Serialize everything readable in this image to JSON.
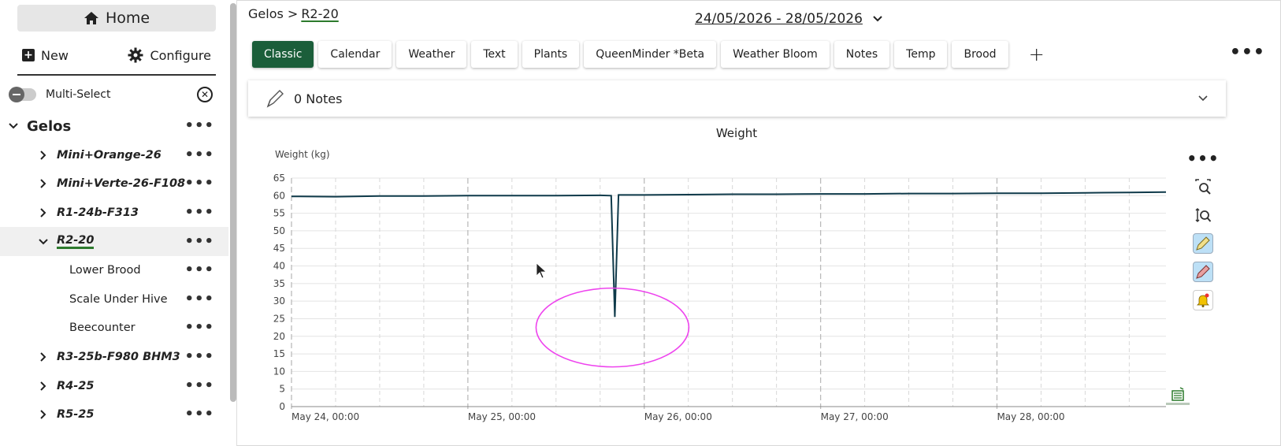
{
  "sidebar": {
    "home_label": "Home",
    "new_label": "New",
    "configure_label": "Configure",
    "multiselect_label": "Multi-Select",
    "tree": [
      {
        "type": "root",
        "label": "Gelos",
        "expanded": true
      },
      {
        "type": "hive",
        "label": "Mini+Orange-26",
        "expanded": false
      },
      {
        "type": "hive",
        "label": "Mini+Verte-26-F108",
        "expanded": false
      },
      {
        "type": "hive",
        "label": "R1-24b-F313",
        "expanded": false
      },
      {
        "type": "hive",
        "label": "R2-20",
        "expanded": true,
        "selected": true
      },
      {
        "type": "sub",
        "label": "Lower Brood"
      },
      {
        "type": "sub",
        "label": "Scale Under Hive"
      },
      {
        "type": "sub",
        "label": "Beecounter"
      },
      {
        "type": "hive",
        "label": "R3-25b-F980 BHM3",
        "expanded": false
      },
      {
        "type": "hive",
        "label": "R4-25",
        "expanded": false
      },
      {
        "type": "hive",
        "label": "R5-25",
        "expanded": false
      }
    ]
  },
  "header": {
    "breadcrumb_root": "Gelos >",
    "breadcrumb_current": "R2-20",
    "date_range": "24/05/2026 - 28/05/2026"
  },
  "tabs": [
    {
      "label": "Classic",
      "active": true
    },
    {
      "label": "Calendar"
    },
    {
      "label": "Weather"
    },
    {
      "label": "Text"
    },
    {
      "label": "Plants"
    },
    {
      "label": "QueenMinder *Beta"
    },
    {
      "label": "Weather Bloom"
    },
    {
      "label": "Notes"
    },
    {
      "label": "Temp"
    },
    {
      "label": "Brood"
    }
  ],
  "notes_bar": {
    "label": "0 Notes"
  },
  "colors": {
    "accent": "#1b5e3a",
    "line": "#0f3a4a",
    "highlight_ellipse": "#ee44ee",
    "selected_underline": "#2d7a2d"
  },
  "chart_data": {
    "type": "line",
    "title": "Weight",
    "ylabel": "Weight (kg)",
    "xlabel": "",
    "ylim": [
      0,
      65
    ],
    "yticks": [
      0,
      5,
      10,
      15,
      20,
      25,
      30,
      35,
      40,
      45,
      50,
      55,
      60,
      65
    ],
    "xlim": [
      "May 24, 00:00",
      "May 28, 23:00"
    ],
    "xtick_labels": [
      "May 24, 00:00",
      "May 25, 00:00",
      "May 26, 00:00",
      "May 27, 00:00",
      "May 28, 00:00"
    ],
    "grid": true,
    "series": [
      {
        "points": [
          [
            "May 24, 00:00",
            59.8
          ],
          [
            "May 24, 06:00",
            59.7
          ],
          [
            "May 24, 12:00",
            59.9
          ],
          [
            "May 24, 18:00",
            59.9
          ],
          [
            "May 25, 00:00",
            60.0
          ],
          [
            "May 25, 06:00",
            60.0
          ],
          [
            "May 25, 12:00",
            60.0
          ],
          [
            "May 25, 18:00",
            60.1
          ],
          [
            "May 25, 19:30",
            60.0
          ],
          [
            "May 25, 20:00",
            25.5
          ],
          [
            "May 25, 20:30",
            60.2
          ],
          [
            "May 26, 00:00",
            60.2
          ],
          [
            "May 26, 06:00",
            60.3
          ],
          [
            "May 26, 12:00",
            60.4
          ],
          [
            "May 26, 18:00",
            60.4
          ],
          [
            "May 27, 00:00",
            60.5
          ],
          [
            "May 27, 06:00",
            60.5
          ],
          [
            "May 27, 12:00",
            60.6
          ],
          [
            "May 27, 18:00",
            60.6
          ],
          [
            "May 28, 00:00",
            60.7
          ],
          [
            "May 28, 06:00",
            60.7
          ],
          [
            "May 28, 12:00",
            60.8
          ],
          [
            "May 28, 18:00",
            60.9
          ],
          [
            "May 28, 23:00",
            61.0
          ]
        ]
      }
    ],
    "annotation": {
      "shape": "ellipse",
      "center": [
        "May 25, 20:00",
        22.5
      ],
      "color": "#ee44ee"
    }
  }
}
